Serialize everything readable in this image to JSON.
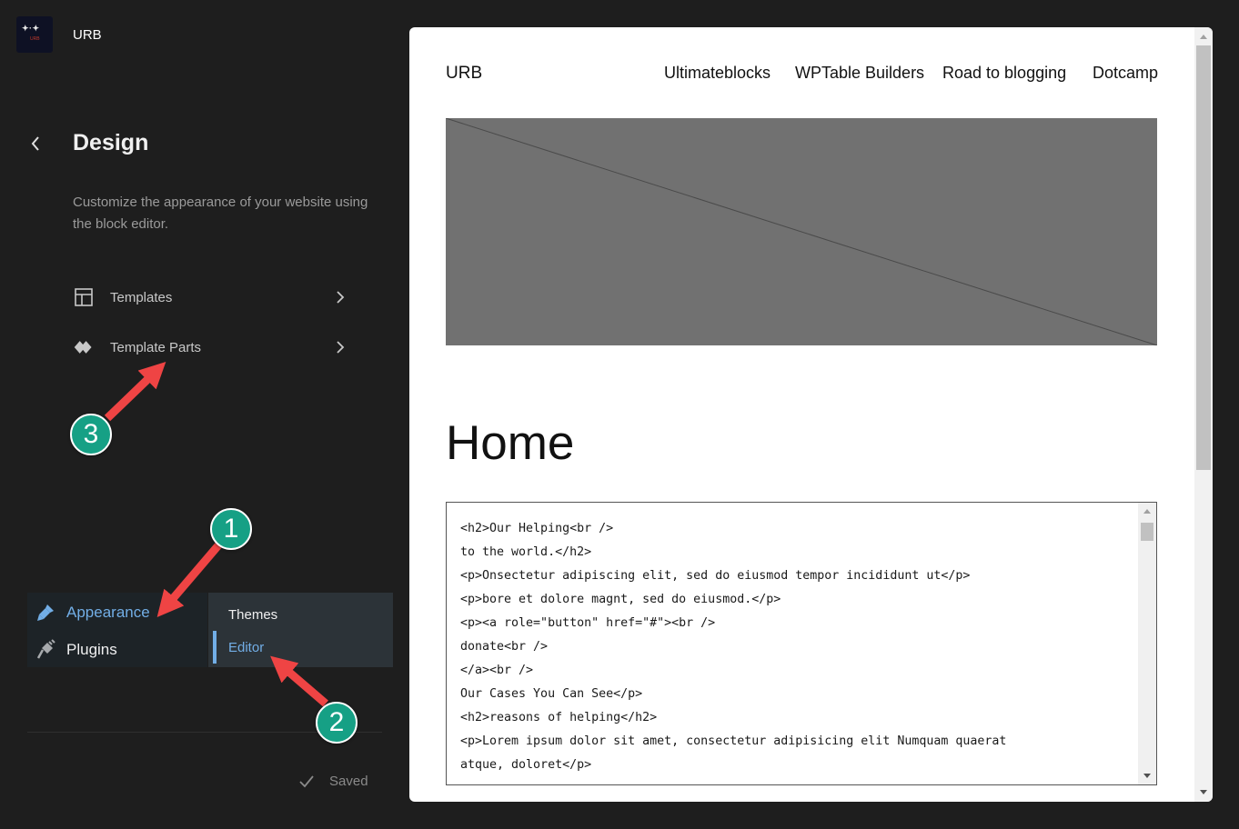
{
  "site": {
    "name": "URB",
    "logo_text": "URB"
  },
  "sidebar": {
    "title": "Design",
    "description": "Customize the appearance of your website using the block editor.",
    "items": [
      {
        "label": "Templates",
        "icon": "layout-icon"
      },
      {
        "label": "Template Parts",
        "icon": "diamond-icon"
      }
    ],
    "saved_label": "Saved"
  },
  "admin_menu": {
    "items": [
      {
        "label": "Appearance",
        "icon": "paintbrush-icon",
        "active": true
      },
      {
        "label": "Plugins",
        "icon": "plugin-icon",
        "active": false
      }
    ],
    "submenu": [
      {
        "label": "Themes"
      },
      {
        "label": "Editor",
        "current": true
      }
    ]
  },
  "callouts": [
    {
      "number": "1"
    },
    {
      "number": "2"
    },
    {
      "number": "3"
    }
  ],
  "preview": {
    "site_title": "URB",
    "nav": [
      "Ultimateblocks",
      "WPTable Builders",
      "Road to blogging",
      "Dotcamp"
    ],
    "page_title": "Home",
    "code_lines": [
      "<h2>Our Helping<br />",
      "to the world.</h2>",
      "<p>Onsectetur adipiscing elit, sed do eiusmod tempor incididunt ut</p>",
      "<p>bore et dolore magnt, sed do eiusmod.</p>",
      "<p><a role=\"button\" href=\"#\"><br />",
      "donate<br />",
      "</a><br />",
      "Our Cases You Can See</p>",
      "<h2>reasons of helping</h2>",
      "<p>Lorem ipsum dolor sit amet, consectetur adipisicing elit Numquam quaerat",
      "atque, doloret</p>"
    ]
  },
  "colors": {
    "background": "#1e1e1e",
    "admin_menu": "#1d2327",
    "submenu": "#2c3338",
    "accent": "#72aee6",
    "callout": "#16a085",
    "arrow": "#ef4444",
    "cover": "#717171"
  }
}
